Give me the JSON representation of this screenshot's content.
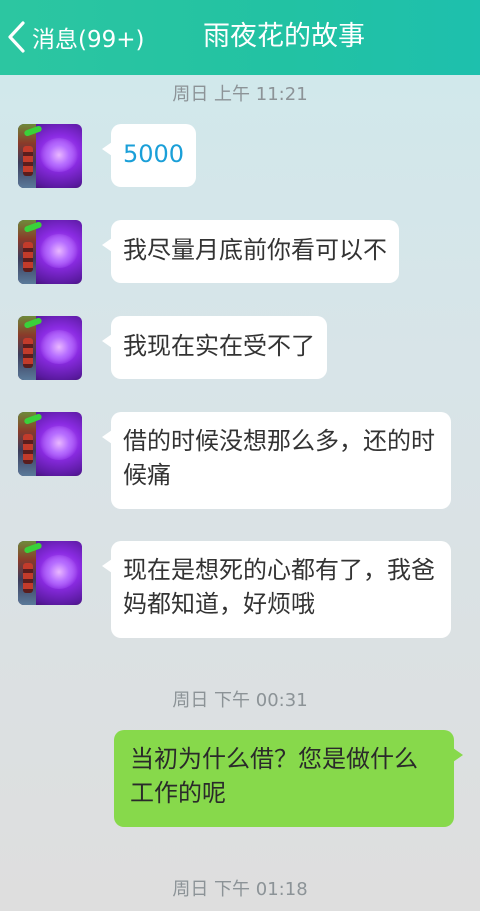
{
  "header": {
    "back_label": "消息(99+)",
    "title": "雨夜花的故事"
  },
  "timestamps": [
    "周日 上午 11:21",
    "周日 下午 00:31",
    "周日 下午 01:18"
  ],
  "messages": [
    {
      "from": "other",
      "text": "5000"
    },
    {
      "from": "other",
      "text": "我尽量月底前你看可以不"
    },
    {
      "from": "other",
      "text": "我现在实在受不了"
    },
    {
      "from": "other",
      "text": "借的时候没想那么多，还的时候痛"
    },
    {
      "from": "other",
      "text": "现在是想死的心都有了，我爸妈都知道，好烦哦"
    },
    {
      "from": "me",
      "text": "当初为什么借？您是做什么工作的呢"
    }
  ],
  "colors": {
    "header": "#25c3a6",
    "my_bubble": "#87d94b",
    "link_text": "#1a9fd8"
  },
  "icons": {
    "back": "chevron-left-icon"
  }
}
